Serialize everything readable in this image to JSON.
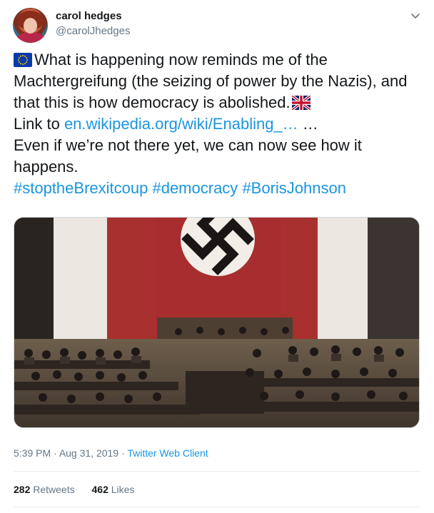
{
  "author": {
    "name": "carol hedges",
    "handle": "@carolJhedges"
  },
  "tweet": {
    "line1": "What is happening now reminds me of the",
    "line2": "Machtergreifung (the seizing of power by the Nazis), and",
    "line3": "that this is how democracy is abolished.",
    "link_prefix": "Link to ",
    "link": "en.wikipedia.org/wiki/Enabling_…",
    "link_suffix": " …",
    "line5": "Even if we’re not there yet, we can now see how it",
    "line6": "happens.",
    "hashtags": [
      "#stoptheBrexitcoup",
      "#democracy",
      "#BorisJohnson"
    ]
  },
  "meta": {
    "time": "5:39 PM",
    "separator": " · ",
    "date": "Aug 31, 2019",
    "source": "Twitter Web Client"
  },
  "stats": {
    "retweets_count": "282",
    "retweets_label": "Retweets",
    "likes_count": "462",
    "likes_label": "Likes"
  },
  "icons": {
    "menu": "chevron-down-icon",
    "flag1": "eu-flag-icon",
    "flag2": "uk-flag-icon"
  },
  "colors": {
    "link": "#1b95e0",
    "secondary_text": "#657786",
    "primary_text": "#14171a"
  }
}
